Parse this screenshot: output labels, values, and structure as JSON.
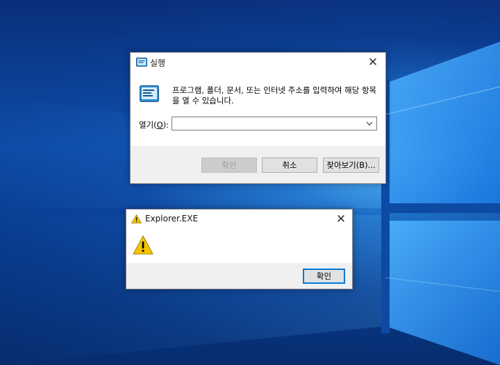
{
  "desktop": {
    "accent": "#0a4fb0"
  },
  "run_dialog": {
    "title": "실행",
    "description": "프로그램, 폴더, 문서, 또는 인터넷 주소를 입력하여 해당 항목을 열 수 있습니다.",
    "open_label_prefix": "열기(",
    "open_label_key": "O",
    "open_label_suffix": "):",
    "input_value": "",
    "ok_label": "확인",
    "cancel_label": "취소",
    "browse_label": "찾아보기(B)...",
    "close_glyph": "✕"
  },
  "error_dialog": {
    "title": "Explorer.EXE",
    "message": "",
    "ok_label": "확인",
    "close_glyph": "✕",
    "warn_color": "#f7c600"
  }
}
